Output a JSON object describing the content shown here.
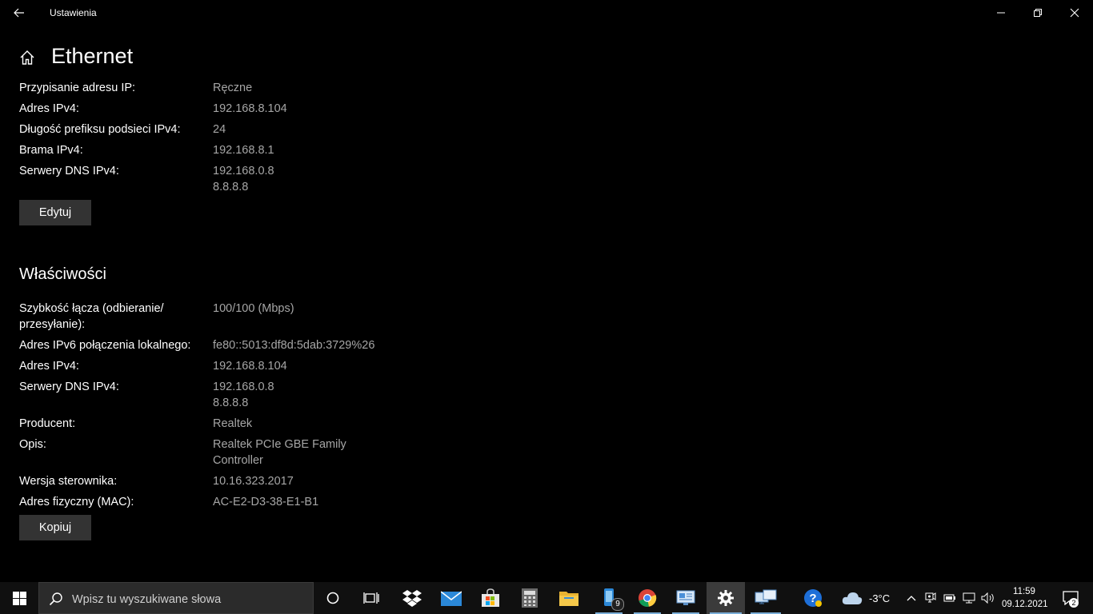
{
  "window": {
    "title": "Ustawienia",
    "page_title": "Ethernet"
  },
  "ip_settings": {
    "rows": [
      {
        "label": "Przypisanie adresu IP:",
        "value": "Ręczne"
      },
      {
        "label": "Adres IPv4:",
        "value": "192.168.8.104"
      },
      {
        "label": "Długość prefiksu podsieci IPv4:",
        "value": "24"
      },
      {
        "label": "Brama IPv4:",
        "value": "192.168.8.1"
      },
      {
        "label": "Serwery DNS IPv4:",
        "value": "192.168.0.8",
        "value2": "8.8.8.8"
      }
    ],
    "edit_button": "Edytuj"
  },
  "properties": {
    "title": "Właściwości",
    "rows": [
      {
        "label": "Szybkość łącza (odbieranie/",
        "label2": "przesyłanie):",
        "value": "100/100 (Mbps)"
      },
      {
        "label": "Adres IPv6 połączenia lokalnego:",
        "value": "fe80::5013:df8d:5dab:3729%26"
      },
      {
        "label": "Adres IPv4:",
        "value": "192.168.8.104"
      },
      {
        "label": "Serwery DNS IPv4:",
        "value": "192.168.0.8",
        "value2": "8.8.8.8"
      },
      {
        "label": "Producent:",
        "value": "Realtek"
      },
      {
        "label": "Opis:",
        "value": "Realtek PCIe GBE Family",
        "value2": "Controller"
      },
      {
        "label": "Wersja sterownika:",
        "value": "10.16.323.2017"
      },
      {
        "label": "Adres fizyczny (MAC):",
        "value": "AC-E2-D3-38-E1-B1"
      }
    ],
    "copy_button": "Kopiuj"
  },
  "taskbar": {
    "search_placeholder": "Wpisz tu wyszukiwane słowa",
    "phone_badge": "9",
    "weather": "-3°C",
    "time": "11:59",
    "date": "09.12.2021",
    "notification_count": "2"
  },
  "colors": {
    "background": "#000000",
    "value_text": "#a6a6a6",
    "button": "#333333",
    "taskbar": "#101010",
    "accent": "#7aaed8"
  }
}
